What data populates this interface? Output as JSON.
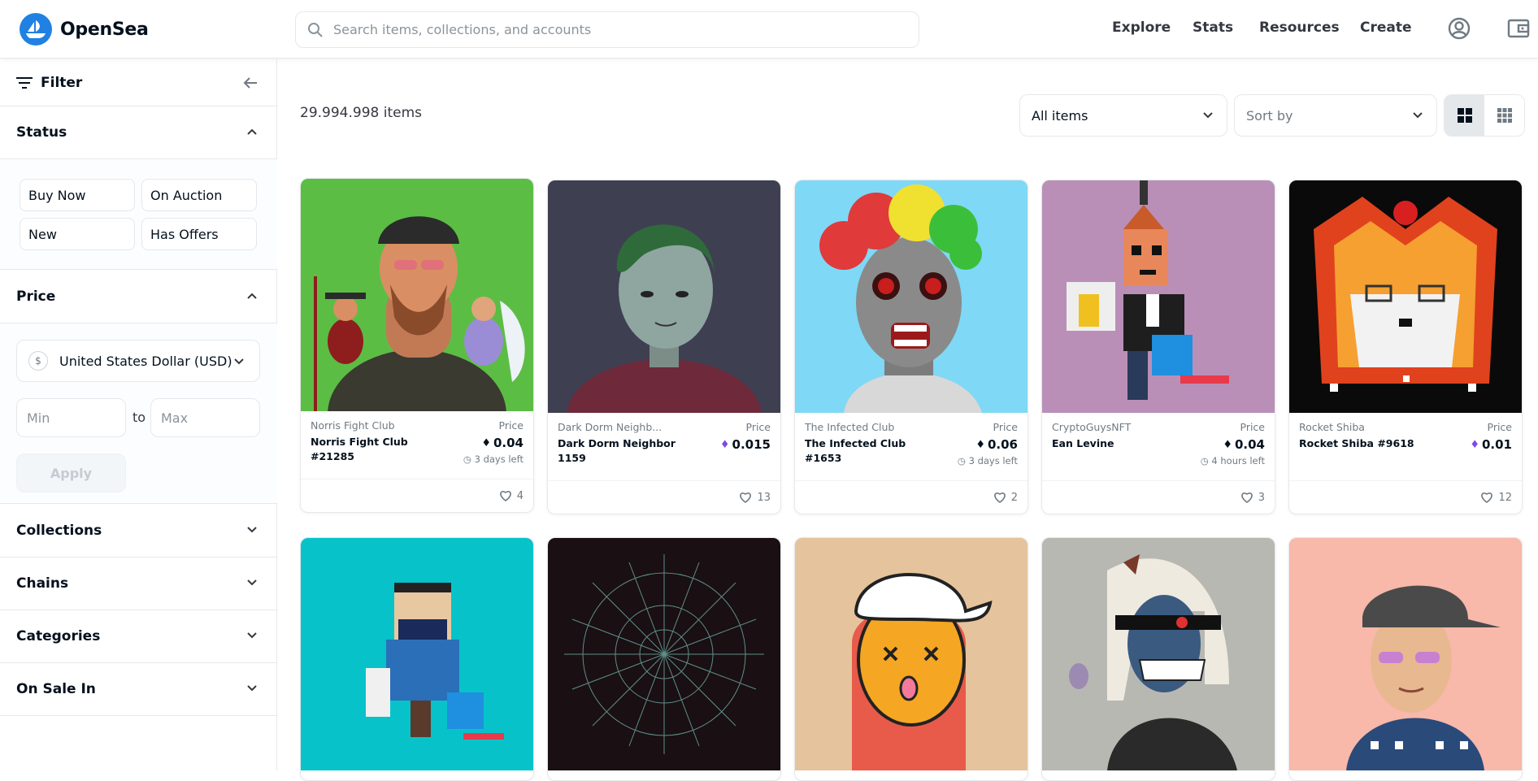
{
  "brand": {
    "name": "OpenSea",
    "color": "#2081e2"
  },
  "search": {
    "placeholder": "Search items, collections, and accounts"
  },
  "nav": {
    "explore": "Explore",
    "stats": "Stats",
    "resources": "Resources",
    "create": "Create"
  },
  "filter": {
    "title": "Filter",
    "status": {
      "title": "Status",
      "options": [
        "Buy Now",
        "On Auction",
        "New",
        "Has Offers"
      ]
    },
    "price": {
      "title": "Price",
      "currency": "United States Dollar (USD)",
      "currency_symbol": "$",
      "min_placeholder": "Min",
      "max_placeholder": "Max",
      "to": "to",
      "apply": "Apply"
    },
    "sections": [
      "Collections",
      "Chains",
      "Categories",
      "On Sale In"
    ]
  },
  "main": {
    "count": "29.994.998 items",
    "all_items": "All items",
    "sort_by": "Sort by"
  },
  "cards": [
    {
      "collection": "Norris Fight Club",
      "name": "Norris Fight Club #21285",
      "price_label": "Price",
      "price": "0.04",
      "currency": "eth",
      "time": "3 days left",
      "likes": "4"
    },
    {
      "collection": "Dark Dorm Neighb...",
      "name": "Dark Dorm Neighbor 1159",
      "price_label": "Price",
      "price": "0.015",
      "currency": "matic",
      "time": "",
      "likes": "13"
    },
    {
      "collection": "The Infected Club",
      "name": "The Infected Club #1653",
      "price_label": "Price",
      "price": "0.06",
      "currency": "eth",
      "time": "3 days left",
      "likes": "2"
    },
    {
      "collection": "CryptoGuysNFT",
      "name": "Ean Levine",
      "price_label": "Price",
      "price": "0.04",
      "currency": "eth",
      "time": "4 hours left",
      "likes": "3"
    },
    {
      "collection": "Rocket Shiba",
      "name": "Rocket Shiba #9618",
      "price_label": "Price",
      "price": "0.01",
      "currency": "matic",
      "time": "",
      "likes": "12"
    }
  ]
}
